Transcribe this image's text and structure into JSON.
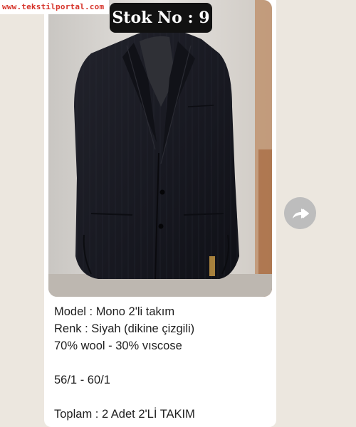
{
  "watermark": {
    "text": "www.tekstilportal.com"
  },
  "message": {
    "stock_badge": "Stok No : 9",
    "image_icon": "black-suit-jacket-photo",
    "caption": {
      "model": "Model : Mono 2'li takım",
      "color": "Renk : Siyah (dikine çizgili)",
      "fabric": "70% wool - 30% vıscose",
      "sizes": "56/1 - 60/1",
      "total": "Toplam : 2 Adet 2'Lİ TAKIM"
    }
  },
  "forward_button": {
    "icon": "forward-icon"
  },
  "colors": {
    "background": "#ece7df",
    "card": "#ffffff",
    "badge": "#111111",
    "forward_button": "#bdbdbd",
    "watermark_text": "#d6332a"
  }
}
